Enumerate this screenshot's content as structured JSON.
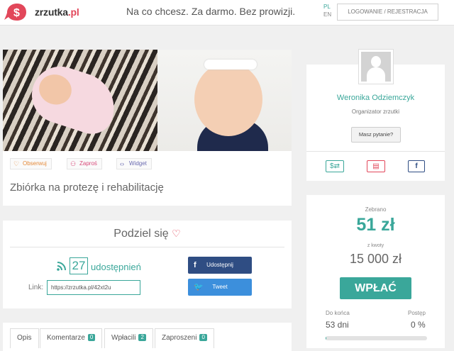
{
  "header": {
    "logo_name": "zrzutka",
    "logo_tld": ".pl",
    "tagline": "Na co chcesz. Za darmo. Bez prowizji.",
    "languages": [
      "PL",
      "EN"
    ],
    "active_language": "PL",
    "login_label": "LOGOWANIE / REJESTRACJA"
  },
  "campaign": {
    "title": "Zbiórka na protezę i rehabilitację",
    "actions": {
      "follow": "Obserwuj",
      "invite": "Zaproś",
      "widget": "Widget"
    }
  },
  "share": {
    "title": "Podziel się",
    "count": "27",
    "count_label": "udostępnień",
    "link_label": "Link:",
    "link_value": "https://zrzutka.pl/42xt2u",
    "facebook_label": "Udostępnij",
    "twitter_label": "Tweet"
  },
  "tabs": [
    {
      "label": "Opis"
    },
    {
      "label": "Komentarze",
      "badge": "0"
    },
    {
      "label": "Wpłacili",
      "badge": "2"
    },
    {
      "label": "Zaproszeni",
      "badge": "0"
    }
  ],
  "organizer": {
    "name": "Weronika Odziemczyk",
    "role": "Organizator zrzutki",
    "ask_label": "Masz pytanie?"
  },
  "funding": {
    "raised_label": "Zebrano",
    "raised_value": "51 zł",
    "goal_label": "z kwoty",
    "goal_value": "15 000 zł",
    "donate_label": "WPŁAĆ",
    "deadline_label": "Do końca",
    "deadline_value": "53 dni",
    "progress_label": "Postęp",
    "progress_value": "0 %",
    "progress_fraction": 0.0034
  },
  "colors": {
    "accent": "#3aa79a",
    "brand": "#e2475a",
    "facebook": "#2f4d83",
    "twitter": "#3c8fdc"
  },
  "icons": {
    "follow": "heart-icon",
    "invite": "user-plus-icon",
    "widget": "code-icon",
    "share": "rss-icon"
  }
}
